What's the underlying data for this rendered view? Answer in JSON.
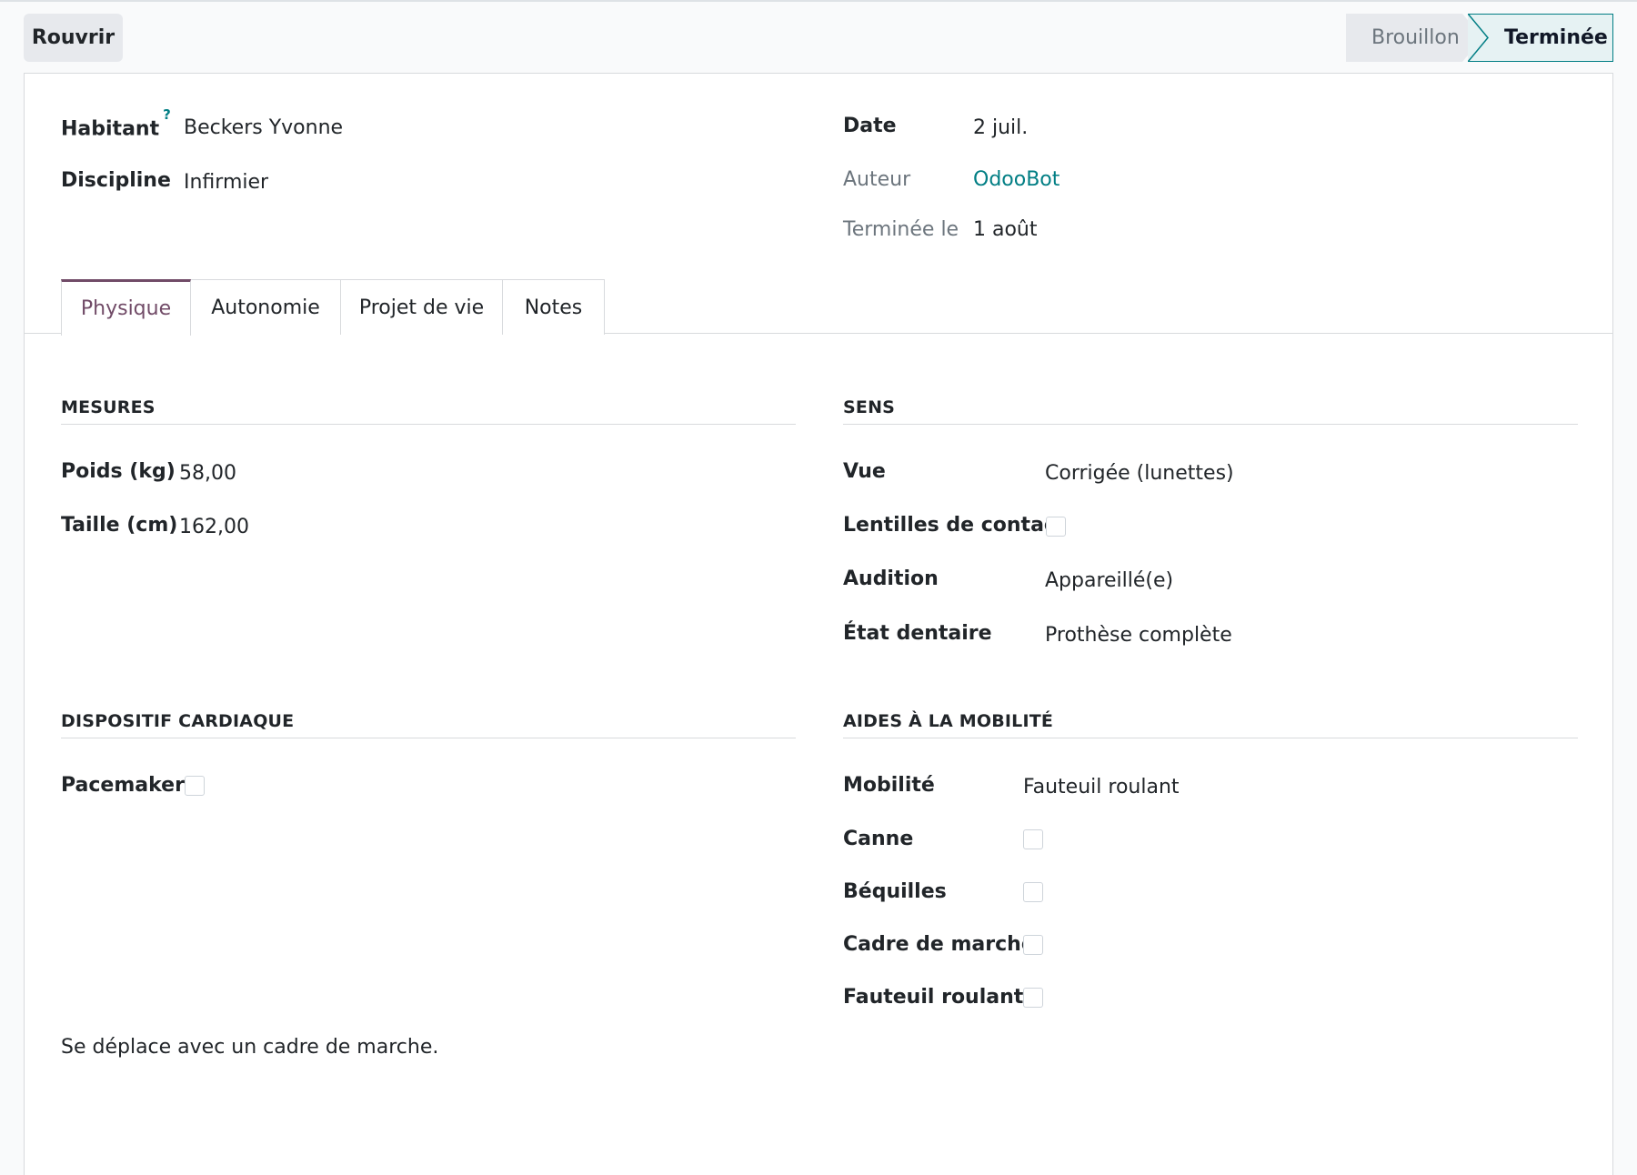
{
  "control_panel": {
    "reopen_label": "Rouvrir",
    "statuses": [
      "Brouillon",
      "Terminée"
    ],
    "active_status": "Terminée"
  },
  "header": {
    "resident_label": "Habitant",
    "resident_help": "?",
    "resident_value": "Beckers Yvonne",
    "discipline_label": "Discipline",
    "discipline_value": "Infirmier",
    "date_label": "Date",
    "date_value": "2 juil.",
    "author_label": "Auteur",
    "author_value": "OdooBot",
    "completed_label": "Terminée le",
    "completed_value": "1 août"
  },
  "tabs": [
    {
      "label": "Physique",
      "active": true
    },
    {
      "label": "Autonomie",
      "active": false
    },
    {
      "label": "Projet de vie",
      "active": false
    },
    {
      "label": "Notes",
      "active": false
    }
  ],
  "measures": {
    "title": "MESURES",
    "weight_label": "Poids (kg)",
    "weight_value": "58,00",
    "height_label": "Taille (cm)",
    "height_value": "162,00"
  },
  "senses": {
    "title": "SENS",
    "vision_label": "Vue",
    "vision_value": "Corrigée (lunettes)",
    "contacts_label": "Lentilles de contact",
    "contacts_checked": false,
    "hearing_label": "Audition",
    "hearing_value": "Appareillé(e)",
    "dental_label": "État dentaire",
    "dental_value": "Prothèse complète"
  },
  "cardiac": {
    "title": "DISPOSITIF CARDIAQUE",
    "pacemaker_label": "Pacemaker",
    "pacemaker_checked": false
  },
  "mobility": {
    "title": "AIDES À LA MOBILITÉ",
    "mobility_label": "Mobilité",
    "mobility_value": "Fauteuil roulant",
    "cane_label": "Canne",
    "crutches_label": "Béquilles",
    "walker_label": "Cadre de marche",
    "wheelchair_label": "Fauteuil roulant"
  },
  "note_text": "Se déplace avec un cadre de marche.",
  "colors": {
    "accent": "#017e84",
    "tab_active": "#714b67",
    "border": "#d8dadd"
  }
}
